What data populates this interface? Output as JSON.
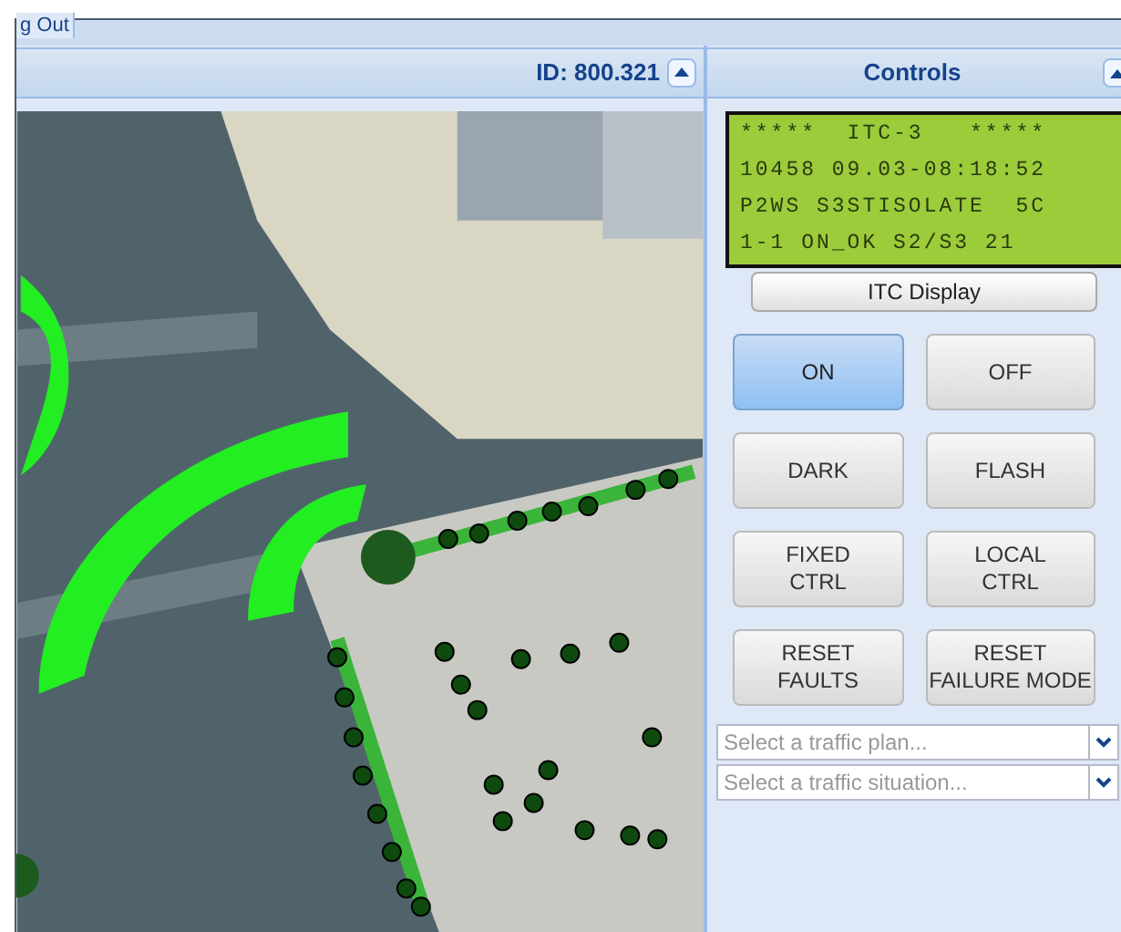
{
  "top_tab": {
    "label": "g Out"
  },
  "map_panel": {
    "title": "ID: 800.321"
  },
  "controls_panel": {
    "title": "Controls",
    "display_lines": [
      "*****  ITC-3   *****",
      "10458 09.03-08:18:52",
      "P2WS S3STISOLATE  5C",
      "1-1 ON_OK S2/S3 21"
    ],
    "display_button": "ITC Display",
    "buttons": [
      {
        "lines": [
          "ON"
        ],
        "selected": true
      },
      {
        "lines": [
          "OFF"
        ],
        "selected": false
      },
      {
        "lines": [
          "DARK"
        ],
        "selected": false
      },
      {
        "lines": [
          "FLASH"
        ],
        "selected": false
      },
      {
        "lines": [
          "FIXED",
          "CTRL"
        ],
        "selected": false
      },
      {
        "lines": [
          "LOCAL",
          "CTRL"
        ],
        "selected": false
      },
      {
        "lines": [
          "RESET",
          "FAULTS"
        ],
        "selected": false
      },
      {
        "lines": [
          "RESET",
          "FAILURE MODE"
        ],
        "selected": false
      }
    ],
    "selects": [
      {
        "placeholder": "Select a traffic plan..."
      },
      {
        "placeholder": "Select a traffic situation..."
      }
    ]
  }
}
